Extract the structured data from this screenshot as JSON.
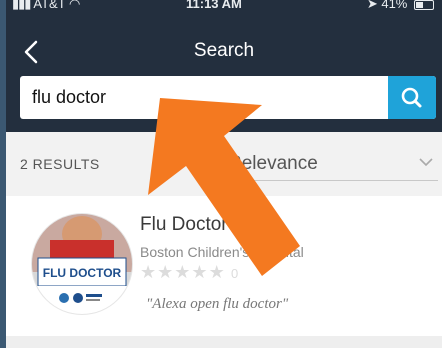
{
  "status_bar": {
    "carrier": "AT&T",
    "time": "11:13 AM",
    "battery": "41%"
  },
  "header": {
    "title": "Search"
  },
  "search": {
    "value": "flu doctor"
  },
  "results": {
    "count_label": "2 RESULTS",
    "sort_label": "Relevance"
  },
  "skill": {
    "name": "Flu Doctor",
    "publisher": "Boston Children's Hospital",
    "rating_count": "0",
    "rating": 0,
    "utterance": "\"Alexa open flu doctor\"",
    "logo_text": "FLU DOCTOR"
  },
  "colors": {
    "header_bg": "#232f3e",
    "accent": "#1fa3d9",
    "annotation_arrow": "#f47920"
  }
}
